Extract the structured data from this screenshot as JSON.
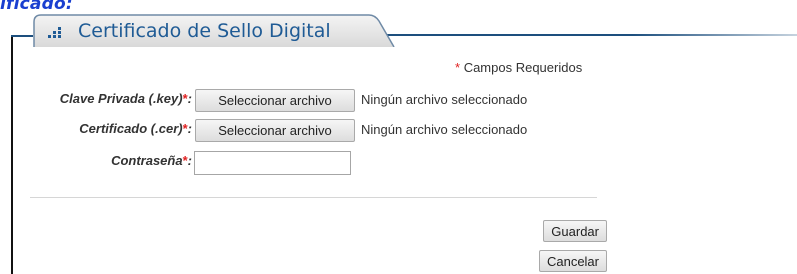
{
  "header": {
    "fragment_text": "ificado:",
    "section_title": "Certificado de Sello Digital",
    "icon": "bar-chart-icon"
  },
  "required_note": {
    "star": "*",
    "text": "Campos Requeridos"
  },
  "form": {
    "key_file": {
      "label": "Clave Privada (.key)",
      "star": "*",
      "colon": ":",
      "button_label": "Seleccionar archivo",
      "status": "Ningún archivo seleccionado"
    },
    "cer_file": {
      "label": "Certificado (.cer)",
      "star": "*",
      "colon": ":",
      "button_label": "Seleccionar archivo",
      "status": "Ningún archivo seleccionado"
    },
    "password": {
      "label": "Contraseña",
      "star": "*",
      "colon": ":",
      "value": ""
    }
  },
  "actions": {
    "save_label": "Guardar",
    "cancel_label": "Cancelar"
  },
  "colors": {
    "accent": "#1f5b95",
    "required": "#e02020",
    "fragment": "#1a3fd0"
  }
}
